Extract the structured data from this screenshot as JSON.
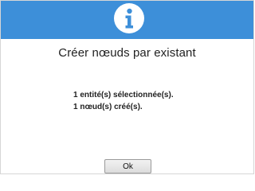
{
  "header": {
    "icon": "info-icon",
    "color": "#3d8fd9"
  },
  "dialog": {
    "title": "Créer nœuds par existant",
    "messages": [
      "1 entité(s) sélectionnée(s).",
      "1 nœud(s) créé(s)."
    ],
    "ok_label": "Ok"
  }
}
